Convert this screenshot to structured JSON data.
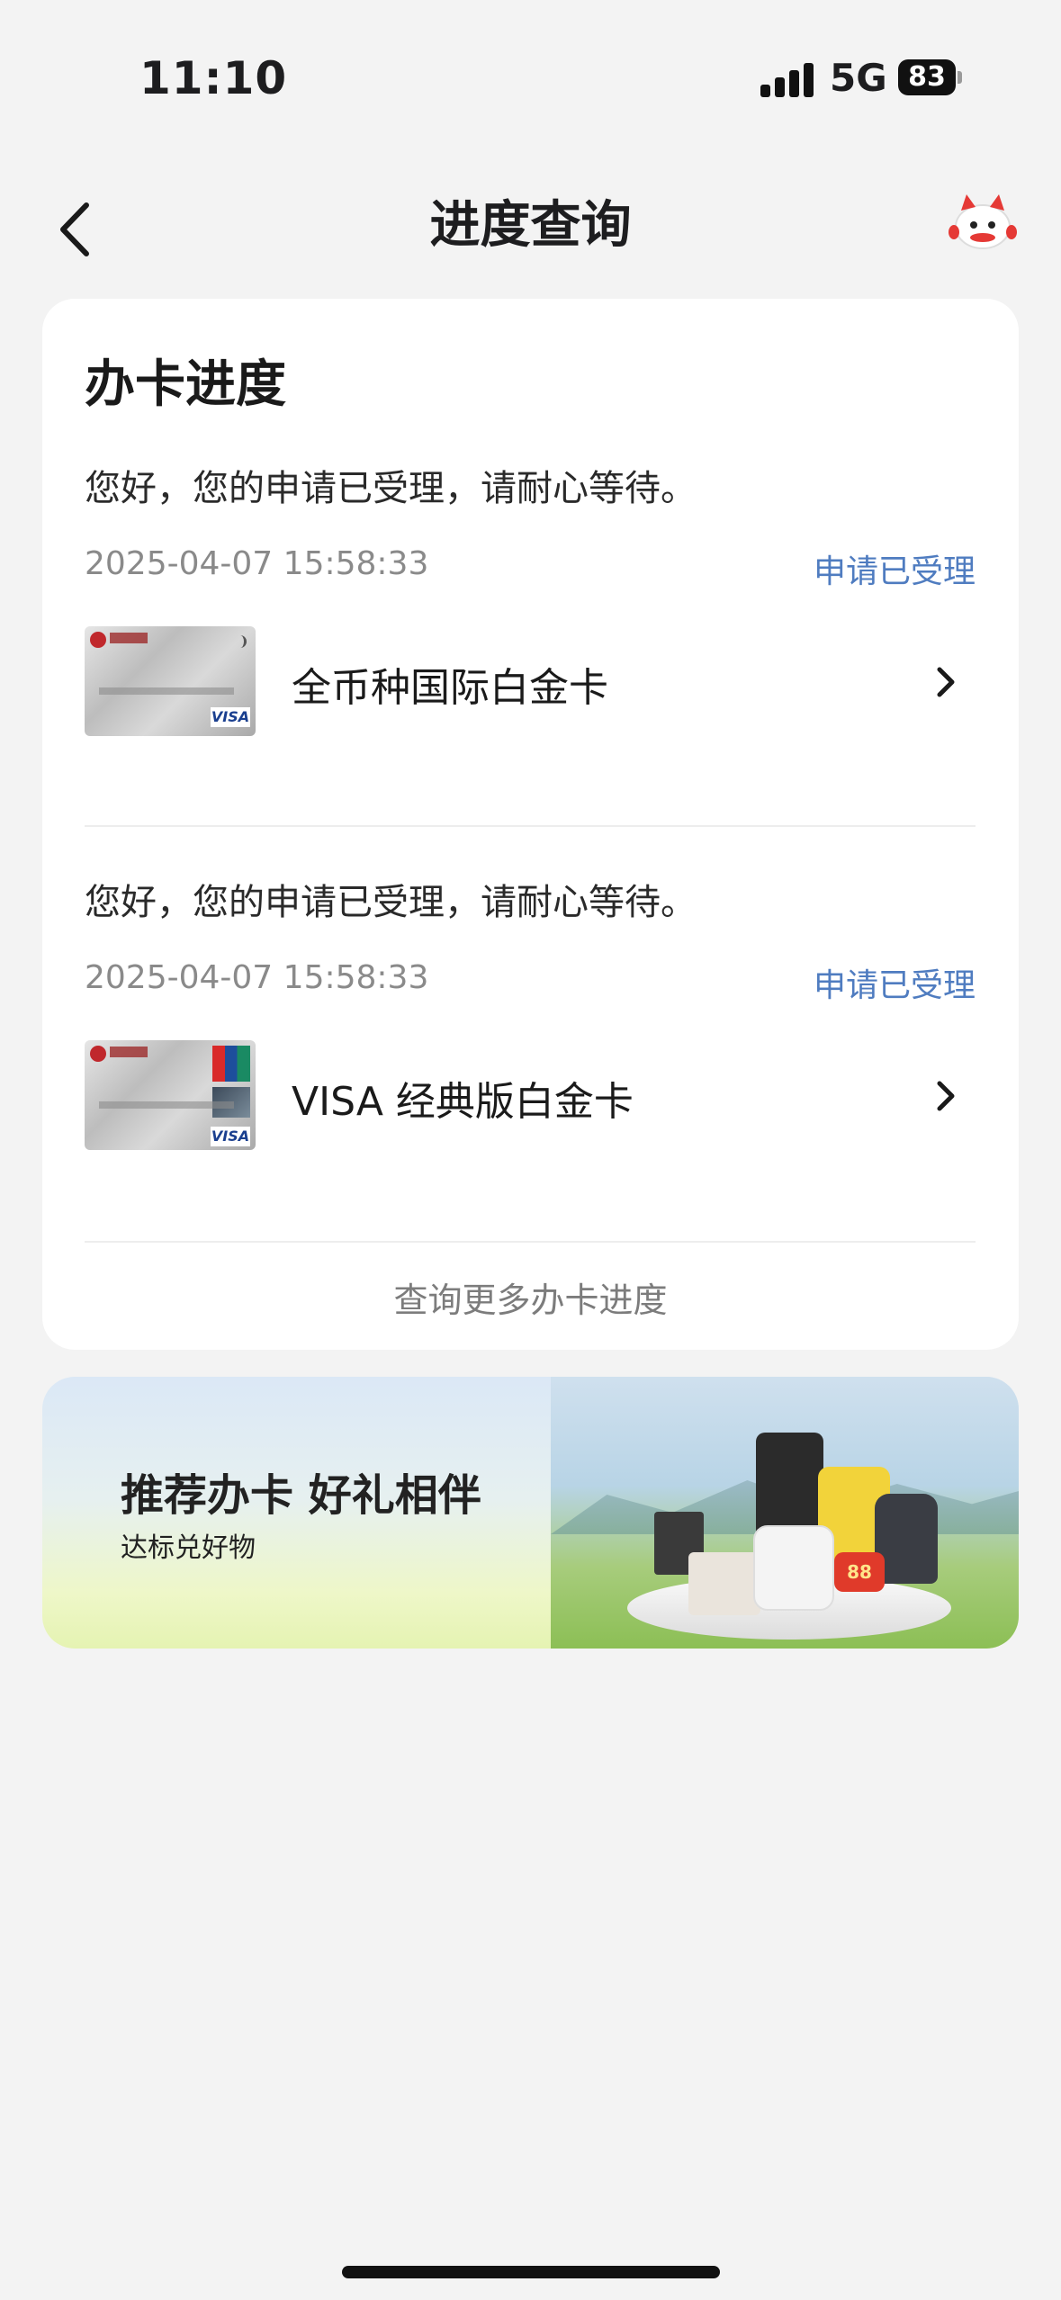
{
  "status_bar": {
    "time": "11:10",
    "network": "5G",
    "battery": "83"
  },
  "nav": {
    "title": "进度查询"
  },
  "card": {
    "title": "办卡进度",
    "applications": [
      {
        "message": "您好，您的申请已受理，请耐心等待。",
        "date": "2025-04-07 15:58:33",
        "status": "申请已受理",
        "card_name": "全币种国际白金卡",
        "card_brand": "VISA"
      },
      {
        "message": "您好，您的申请已受理，请耐心等待。",
        "date": "2025-04-07 15:58:33",
        "status": "申请已受理",
        "card_name": "VISA 经典版白金卡",
        "card_brand": "VISA"
      }
    ],
    "more_link": "查询更多办卡进度"
  },
  "banner": {
    "title": "推荐办卡 好礼相伴",
    "subtitle": "达标兑好物",
    "badge": "88"
  },
  "colors": {
    "accent_link": "#4f7cc0",
    "background": "#f3f3f3"
  }
}
